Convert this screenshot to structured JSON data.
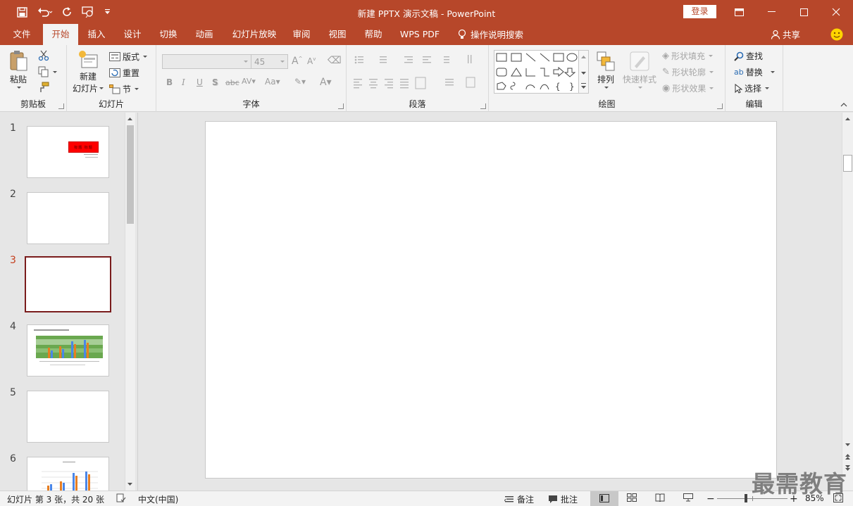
{
  "window": {
    "title": "新建 PPTX 演示文稿 - PowerPoint",
    "login_label": "登录"
  },
  "menu": {
    "tabs": [
      "文件",
      "开始",
      "插入",
      "设计",
      "切换",
      "动画",
      "幻灯片放映",
      "审阅",
      "视图",
      "帮助",
      "WPS PDF"
    ],
    "active": "开始",
    "tell_me": "操作说明搜索",
    "share": "共享"
  },
  "ribbon": {
    "clipboard": {
      "label": "剪贴板",
      "paste": "粘贴"
    },
    "slides": {
      "label": "幻灯片",
      "new_slide_1": "新建",
      "new_slide_2": "幻灯片",
      "layout": "版式",
      "reset": "重置",
      "section": "节"
    },
    "font": {
      "label": "字体",
      "size": "45"
    },
    "paragraph": {
      "label": "段落"
    },
    "drawing": {
      "label": "绘图",
      "arrange": "排列",
      "quick_styles": "快速样式",
      "shape_fill": "形状填充",
      "shape_outline": "形状轮廓",
      "shape_effects": "形状效果"
    },
    "editing": {
      "label": "编辑",
      "find": "查找",
      "replace": "替换",
      "select": "选择"
    }
  },
  "slides_pane": {
    "numbers": [
      "1",
      "2",
      "3",
      "4",
      "5",
      "6"
    ],
    "selected": "3",
    "thumb1_title": "标题  标题"
  },
  "status": {
    "slide_info": "幻灯片 第 3 张，共 20 张",
    "language": "中文(中国)",
    "notes": "备注",
    "comments": "批注",
    "zoom": "85%",
    "minus": "−",
    "plus": "+"
  },
  "watermark": "最需教育",
  "colors": {
    "accent": "#b7472a",
    "selected_border": "#7a1c1c"
  }
}
